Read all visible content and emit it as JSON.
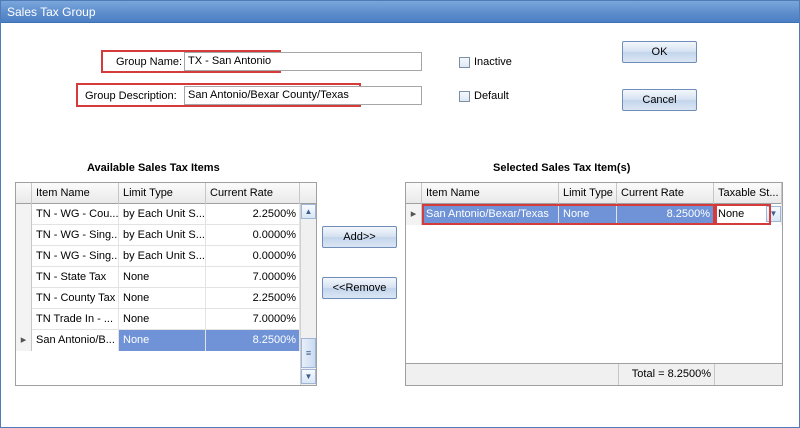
{
  "window": {
    "title": "Sales Tax Group"
  },
  "form": {
    "group_name_label": "Group Name:",
    "group_name_value": "TX - San Antonio",
    "group_description_label": "Group Description:",
    "group_description_value": "San Antonio/Bexar County/Texas",
    "inactive_label": "Inactive",
    "inactive_checked": false,
    "default_label": "Default",
    "default_checked": false
  },
  "buttons": {
    "ok": "OK",
    "cancel": "Cancel",
    "add": "Add>>",
    "remove": "<<Remove"
  },
  "available": {
    "title": "Available Sales Tax Items",
    "columns": [
      "Item Name",
      "Limit Type",
      "Current Rate"
    ],
    "rows": [
      {
        "name": "TN - WG - Cou...",
        "limit": "by Each Unit S...",
        "rate": "2.2500%"
      },
      {
        "name": "TN - WG - Sing...",
        "limit": "by Each Unit S...",
        "rate": "0.0000%"
      },
      {
        "name": "TN - WG - Sing...",
        "limit": "by Each Unit S...",
        "rate": "0.0000%"
      },
      {
        "name": "TN - State Tax",
        "limit": "None",
        "rate": "7.0000%"
      },
      {
        "name": "TN - County Tax",
        "limit": "None",
        "rate": "2.2500%"
      },
      {
        "name": "TN Trade In - ...",
        "limit": "None",
        "rate": "7.0000%"
      },
      {
        "name": "San Antonio/B...",
        "limit": "None",
        "rate": "8.2500%"
      }
    ],
    "selected_row_index": 6
  },
  "selected": {
    "title": "Selected Sales Tax Item(s)",
    "columns": [
      "Item Name",
      "Limit Type",
      "Current Rate",
      "Taxable St..."
    ],
    "rows": [
      {
        "name": "San Antonio/Bexar/Texas",
        "limit": "None",
        "rate": "8.2500%",
        "taxable": "None"
      }
    ],
    "total": "Total = 8.2500%"
  },
  "colors": {
    "title_bar": "#5b8ccb",
    "selection": "#6f93d6",
    "highlight_border": "#d63b3b"
  }
}
